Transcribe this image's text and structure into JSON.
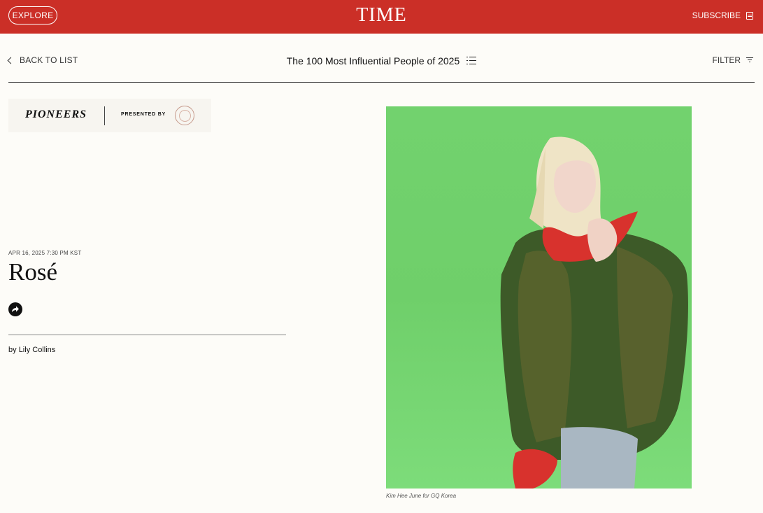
{
  "topbar": {
    "explore_label": "EXPLORE",
    "logo_text": "TIME",
    "subscribe_label": "SUBSCRIBE",
    "background_color": "#cb2f27"
  },
  "subnav": {
    "back_label": "BACK TO LIST",
    "list_title": "The 100 Most Influential People of 2025",
    "filter_label": "FILTER"
  },
  "banner": {
    "category": "PIONEERS",
    "presented_by": "PRESENTED BY",
    "sponsor_logo": "sponsor-seal-icon"
  },
  "article": {
    "date": "APR 16, 2025 7:30 PM KST",
    "name": "Rosé",
    "share_icon": "share-arrow-icon",
    "byline_prefix": "by ",
    "author": "Lily Collins"
  },
  "photo": {
    "background_color": "#6fcf6a",
    "caption": "Kim Hee June for GQ Korea"
  }
}
